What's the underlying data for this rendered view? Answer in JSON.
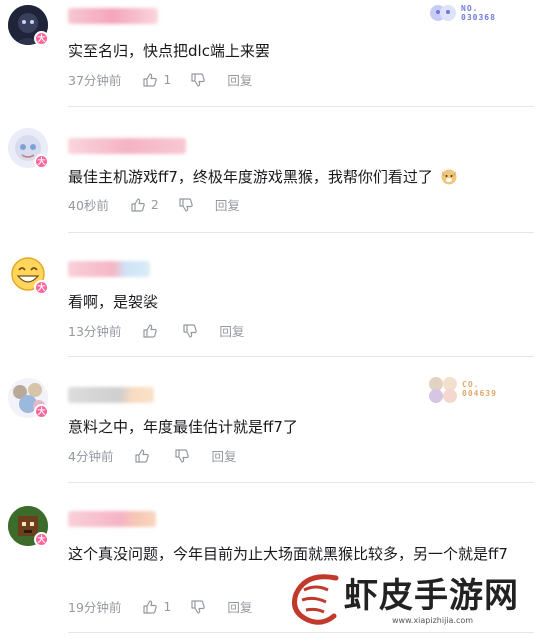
{
  "comments": [
    {
      "content": "实至名归，快点把dlc端上来罢",
      "time": "37分钟前",
      "likes": "1",
      "reply": "回复",
      "fan_badge": {
        "line1": "NO.",
        "line2": "030368",
        "color": "#6f7ad8"
      }
    },
    {
      "content": "最佳主机游戏ff7，终极年度游戏黑猴，我帮你们看过了",
      "time": "40秒前",
      "likes": "2",
      "reply": "回复"
    },
    {
      "content": "看啊，是袈裟",
      "time": "13分钟前",
      "likes": "",
      "reply": "回复"
    },
    {
      "content": "意料之中，年度最佳估计就是ff7了",
      "time": "4分钟前",
      "likes": "",
      "reply": "回复",
      "fan_badge": {
        "line1": "CO.",
        "line2": "004639",
        "color": "#e0a86a"
      }
    },
    {
      "content": "这个真没问题，今年目前为止大场面就黑猴比较多，另一个就是ff7",
      "time": "19分钟前",
      "likes": "1",
      "reply": "回复"
    }
  ],
  "watermark": {
    "title": "虾皮手游网",
    "url": "www.xiapizhijia.com"
  },
  "colors": {
    "text": "#18191c",
    "meta": "#9499a0",
    "divider": "#e3e5e7",
    "badge": "#ff6699"
  }
}
